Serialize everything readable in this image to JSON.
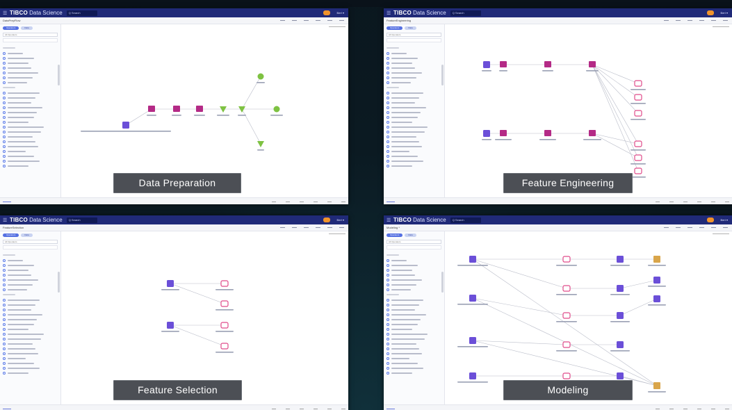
{
  "brand": {
    "name_bold": "TIBCO",
    "name_rest": " Data Science"
  },
  "search_label": "Q Search",
  "user_menu": "Bert ▾",
  "panels": [
    {
      "workflow_name": "DataPrepFlow",
      "caption": "Data Preparation"
    },
    {
      "workflow_name": "FeatureEngineering",
      "caption": "Feature Engineering"
    },
    {
      "workflow_name": "FeatureSelection",
      "caption": "Feature Selection"
    },
    {
      "workflow_name": "Modeling *",
      "caption": "Modeling"
    }
  ],
  "sidebar": {
    "tab_operators": "Operators",
    "tab_data": "Data",
    "select_label": "All Operators"
  },
  "colors": {
    "appbar": "#202a78",
    "node_purple": "#6b4fd8",
    "node_magenta": "#b42a86",
    "node_green": "#7ec242",
    "node_pink": "#e04b8a",
    "node_gold": "#d9a54a",
    "accent": "#5570e2"
  },
  "icons": [
    "menu-icon",
    "search-icon",
    "user-avatar-icon",
    "dataset-node-icon",
    "transform-node-icon",
    "model-node-icon",
    "evaluator-node-icon"
  ]
}
